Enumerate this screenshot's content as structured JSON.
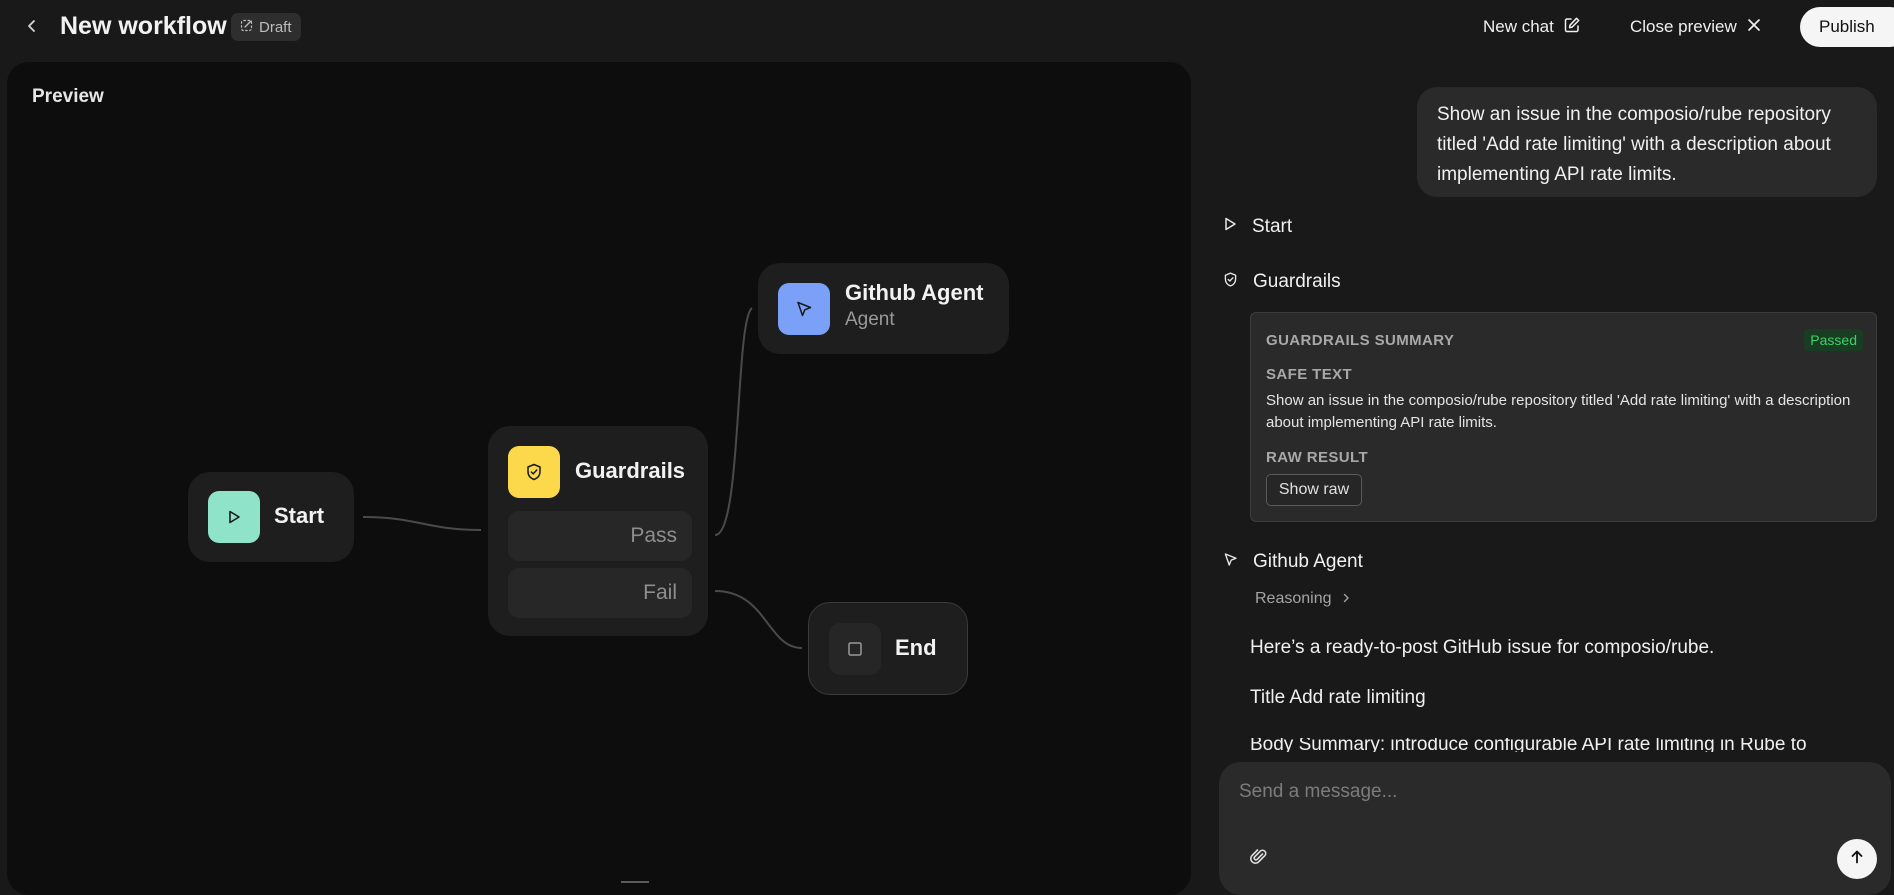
{
  "header": {
    "title": "New workflow",
    "badge": "Draft",
    "new_chat_label": "New chat",
    "close_preview_label": "Close preview",
    "publish_label": "Publish"
  },
  "canvas": {
    "label": "Preview",
    "nodes": {
      "start": {
        "title": "Start",
        "icon": "play-icon",
        "color": "#8fe3c9"
      },
      "guardrails": {
        "title": "Guardrails",
        "icon": "shield-check-icon",
        "color": "#fcd94a",
        "branches": [
          "Pass",
          "Fail"
        ]
      },
      "github_agent": {
        "title": "Github Agent",
        "subtitle": "Agent",
        "icon": "cursor-arrow-icon",
        "color": "#7ba0f7"
      },
      "end": {
        "title": "End",
        "icon": "stop-square-icon"
      }
    }
  },
  "chat": {
    "user_message": "Show an issue in the composio/rube repository titled 'Add rate limiting' with a description about implementing API rate limits.",
    "steps": {
      "start": {
        "label": "Start",
        "icon": "play-outline-icon"
      },
      "guardrails": {
        "label": "Guardrails",
        "icon": "shield-check-icon"
      },
      "agent": {
        "label": "Github Agent",
        "icon": "cursor-arrow-icon"
      }
    },
    "guardrails_card": {
      "summary_label": "GUARDRAILS SUMMARY",
      "status": "Passed",
      "safe_text_label": "SAFE TEXT",
      "safe_text": "Show an issue in the composio/rube repository titled 'Add rate limiting' with a description about implementing API rate limits.",
      "raw_result_label": "RAW RESULT",
      "show_raw_label": "Show raw"
    },
    "reasoning_label": "Reasoning",
    "response": {
      "intro": "Here’s a ready-to-post GitHub issue for composio/rube.",
      "title_line": "Title Add rate limiting",
      "body_cut": "Body Summary: introduce configurable API rate limiting in Rube to"
    },
    "composer_placeholder": "Send a message..."
  },
  "colors": {
    "accent_green": "#3ed16a",
    "publish_bg": "#f5f5f5"
  }
}
